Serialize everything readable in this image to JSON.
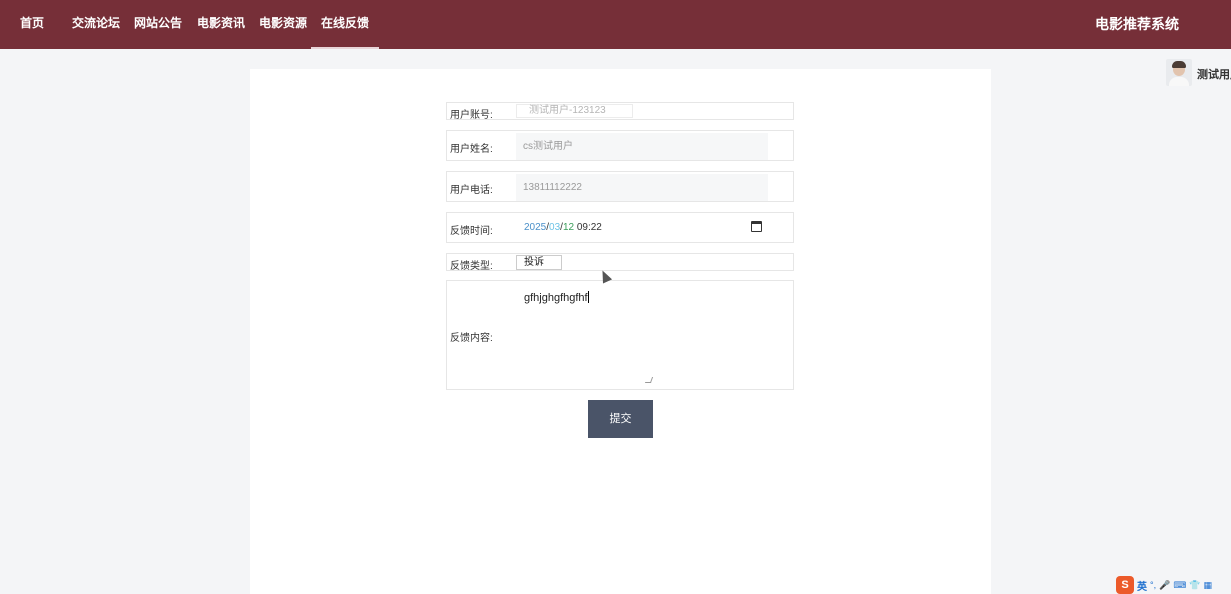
{
  "nav": {
    "items": [
      {
        "label": "首页"
      },
      {
        "label": "交流论坛"
      },
      {
        "label": "网站公告"
      },
      {
        "label": "电影资讯"
      },
      {
        "label": "电影资源"
      },
      {
        "label": "在线反馈"
      }
    ],
    "active_index": 5,
    "brand": "电影推荐系统"
  },
  "user": {
    "name": "测试用户"
  },
  "form": {
    "account": {
      "label": "用户账号:",
      "value": "测试用户-123123"
    },
    "name": {
      "label": "用户姓名:",
      "value": "cs测试用户"
    },
    "phone": {
      "label": "用户电话:",
      "value": "13811112222"
    },
    "time": {
      "label": "反馈时间:",
      "year": "2025",
      "month": "03",
      "day": "12",
      "time": "09:22"
    },
    "type": {
      "label": "反馈类型:",
      "value": "投诉"
    },
    "content": {
      "label": "反馈内容:",
      "value": "gfhjghgfhgfhf"
    },
    "submit_label": "提交"
  },
  "taskbar": {
    "ime_logo": "S",
    "ime_lang": "英",
    "icons": [
      "punctuation-icon",
      "microphone-icon",
      "keyboard-icon",
      "skin-icon",
      "grid-icon"
    ]
  },
  "colors": {
    "nav_bg": "#762f38",
    "button_bg": "#4a5468"
  }
}
